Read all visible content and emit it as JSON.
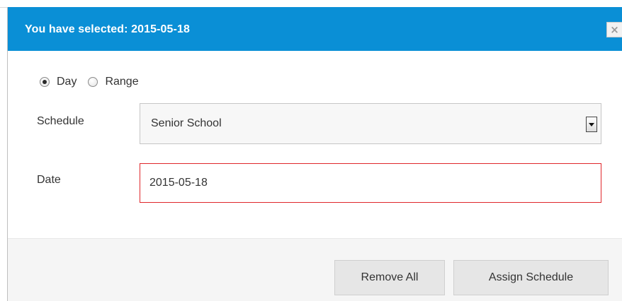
{
  "dialog": {
    "title": "You have selected: 2015-05-18",
    "close_glyph": "×",
    "header_color": "#0a8fd6"
  },
  "mode": {
    "options": [
      {
        "label": "Day",
        "checked": true
      },
      {
        "label": "Range",
        "checked": false
      }
    ]
  },
  "form": {
    "schedule_label": "Schedule",
    "schedule_value": "Senior School",
    "date_label": "Date",
    "date_value": "2015-05-18",
    "date_border_color": "#e0262b"
  },
  "footer": {
    "remove_all_label": "Remove All",
    "assign_label": "Assign Schedule"
  },
  "icons": {
    "close": "close-icon",
    "dropdown": "chevron-down-icon"
  }
}
